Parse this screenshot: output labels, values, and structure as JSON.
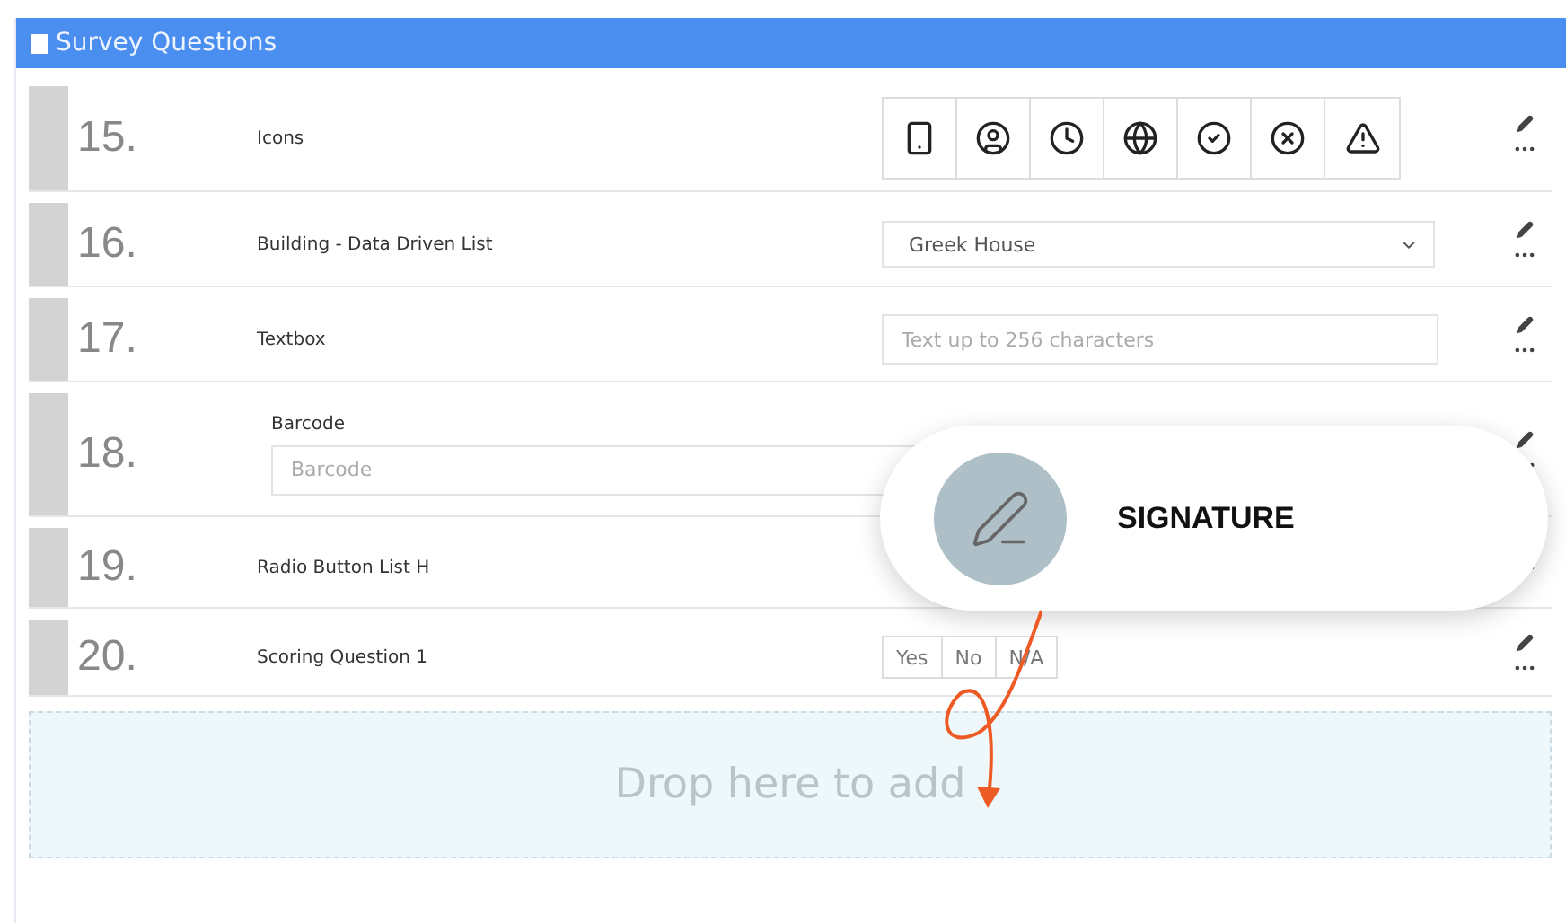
{
  "panel": {
    "title": "Survey Questions"
  },
  "questions": [
    {
      "number": "15.",
      "label": "Icons",
      "kind": "icons"
    },
    {
      "number": "16.",
      "label": "Building - Data Driven List",
      "kind": "select",
      "value": "Greek House"
    },
    {
      "number": "17.",
      "label": "Textbox",
      "kind": "textbox",
      "placeholder": "Text up to 256 characters"
    },
    {
      "number": "18.",
      "label": "Barcode",
      "kind": "barcode",
      "placeholder": "Barcode"
    },
    {
      "number": "19.",
      "label": "Radio Button List H",
      "kind": "radio"
    },
    {
      "number": "20.",
      "label": "Scoring Question 1",
      "kind": "scoring",
      "options": [
        "Yes",
        "No",
        "N/A"
      ]
    }
  ],
  "drop_zone": {
    "text": "Drop here to add"
  },
  "drag_item": {
    "label": "SIGNATURE"
  }
}
